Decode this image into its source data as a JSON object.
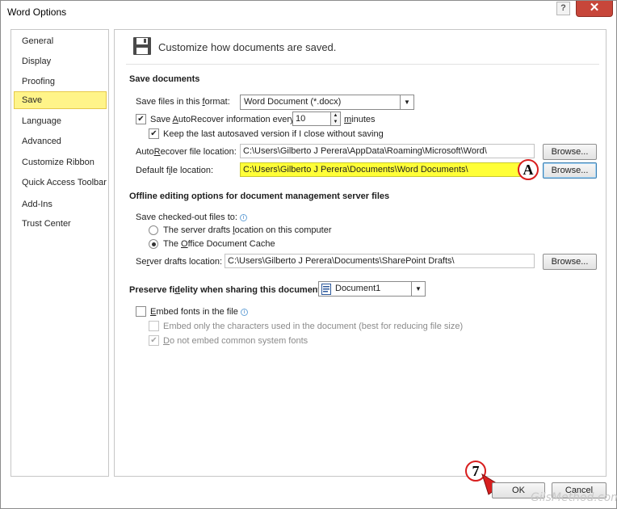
{
  "window": {
    "title": "Word Options",
    "help_label": "?",
    "close_label": "✕"
  },
  "nav": {
    "items": [
      {
        "label": "General"
      },
      {
        "label": "Display"
      },
      {
        "label": "Proofing"
      },
      {
        "label": "Save",
        "selected": true
      },
      {
        "label": "Language"
      },
      {
        "label": "Advanced"
      },
      {
        "label": "Customize Ribbon"
      },
      {
        "label": "Quick Access Toolbar"
      },
      {
        "label": "Add-Ins"
      },
      {
        "label": "Trust Center"
      }
    ]
  },
  "main": {
    "header_text": "Customize how documents are saved.",
    "header_icon": "floppy-disk-icon",
    "save_documents": {
      "heading": "Save documents",
      "format_label_pre": "Save files in this ",
      "format_label_key": "f",
      "format_label_post": "ormat:",
      "format_value": "Word Document (*.docx)",
      "autorecover_checked": true,
      "autorecover_label_pre": "Save ",
      "autorecover_label_key": "A",
      "autorecover_label_post": "utoRecover information every",
      "autorecover_minutes": "10",
      "minutes_label_pre": "",
      "minutes_label_key": "m",
      "minutes_label_post": "inutes",
      "keep_last_checked": true,
      "keep_last_label": "Keep the last autosaved version if I close without saving",
      "autorecover_location_label_pre": "Auto",
      "autorecover_location_label_key": "R",
      "autorecover_location_label_post": "ecover file location:",
      "autorecover_location_value": "C:\\Users\\Gilberto J Perera\\AppData\\Roaming\\Microsoft\\Word\\",
      "default_location_label_pre": "Default f",
      "default_location_label_key": "i",
      "default_location_label_post": "le location:",
      "default_location_value": "C:\\Users\\Gilberto J Perera\\Documents\\Word Documents\\",
      "browse_label": "Browse..."
    },
    "offline": {
      "heading": "Offline editing options for document management server files",
      "checked_out_label": "Save checked-out files to:",
      "option_server_pre": "The server drafts ",
      "option_server_key": "l",
      "option_server_post": "ocation on this computer",
      "option_cache_pre": "The ",
      "option_cache_key": "O",
      "option_cache_post": "ffice Document Cache",
      "cache_selected": true,
      "server_drafts_label_pre": "Se",
      "server_drafts_label_key": "r",
      "server_drafts_label_post": "ver drafts location:",
      "server_drafts_value": "C:\\Users\\Gilberto J Perera\\Documents\\SharePoint Drafts\\",
      "browse_label": "Browse..."
    },
    "fidelity": {
      "heading_pre": "Preserve fi",
      "heading_key": "d",
      "heading_post": "elity when sharing this document:",
      "document_value": "Document1",
      "embed_fonts_checked": false,
      "embed_fonts_label_pre": "",
      "embed_fonts_label_key": "E",
      "embed_fonts_label_post": "mbed fonts in the file",
      "embed_only_label": "Embed only the characters used in the document (best for reducing file size)",
      "embed_only_checked": false,
      "no_common_label_pre": "",
      "no_common_label_key": "D",
      "no_common_label_post": "o not embed common system fonts",
      "no_common_checked": true
    }
  },
  "callouts": {
    "a_label": "A",
    "seven_label": "7"
  },
  "footer": {
    "ok_label": "OK",
    "cancel_label": "Cancel"
  },
  "watermark": "GilsMethod.com",
  "colors": {
    "highlight_yellow": "#ffff38",
    "nav_selected": "#fff489",
    "callout_red": "#d81e1e",
    "close_red": "#c7463a"
  }
}
